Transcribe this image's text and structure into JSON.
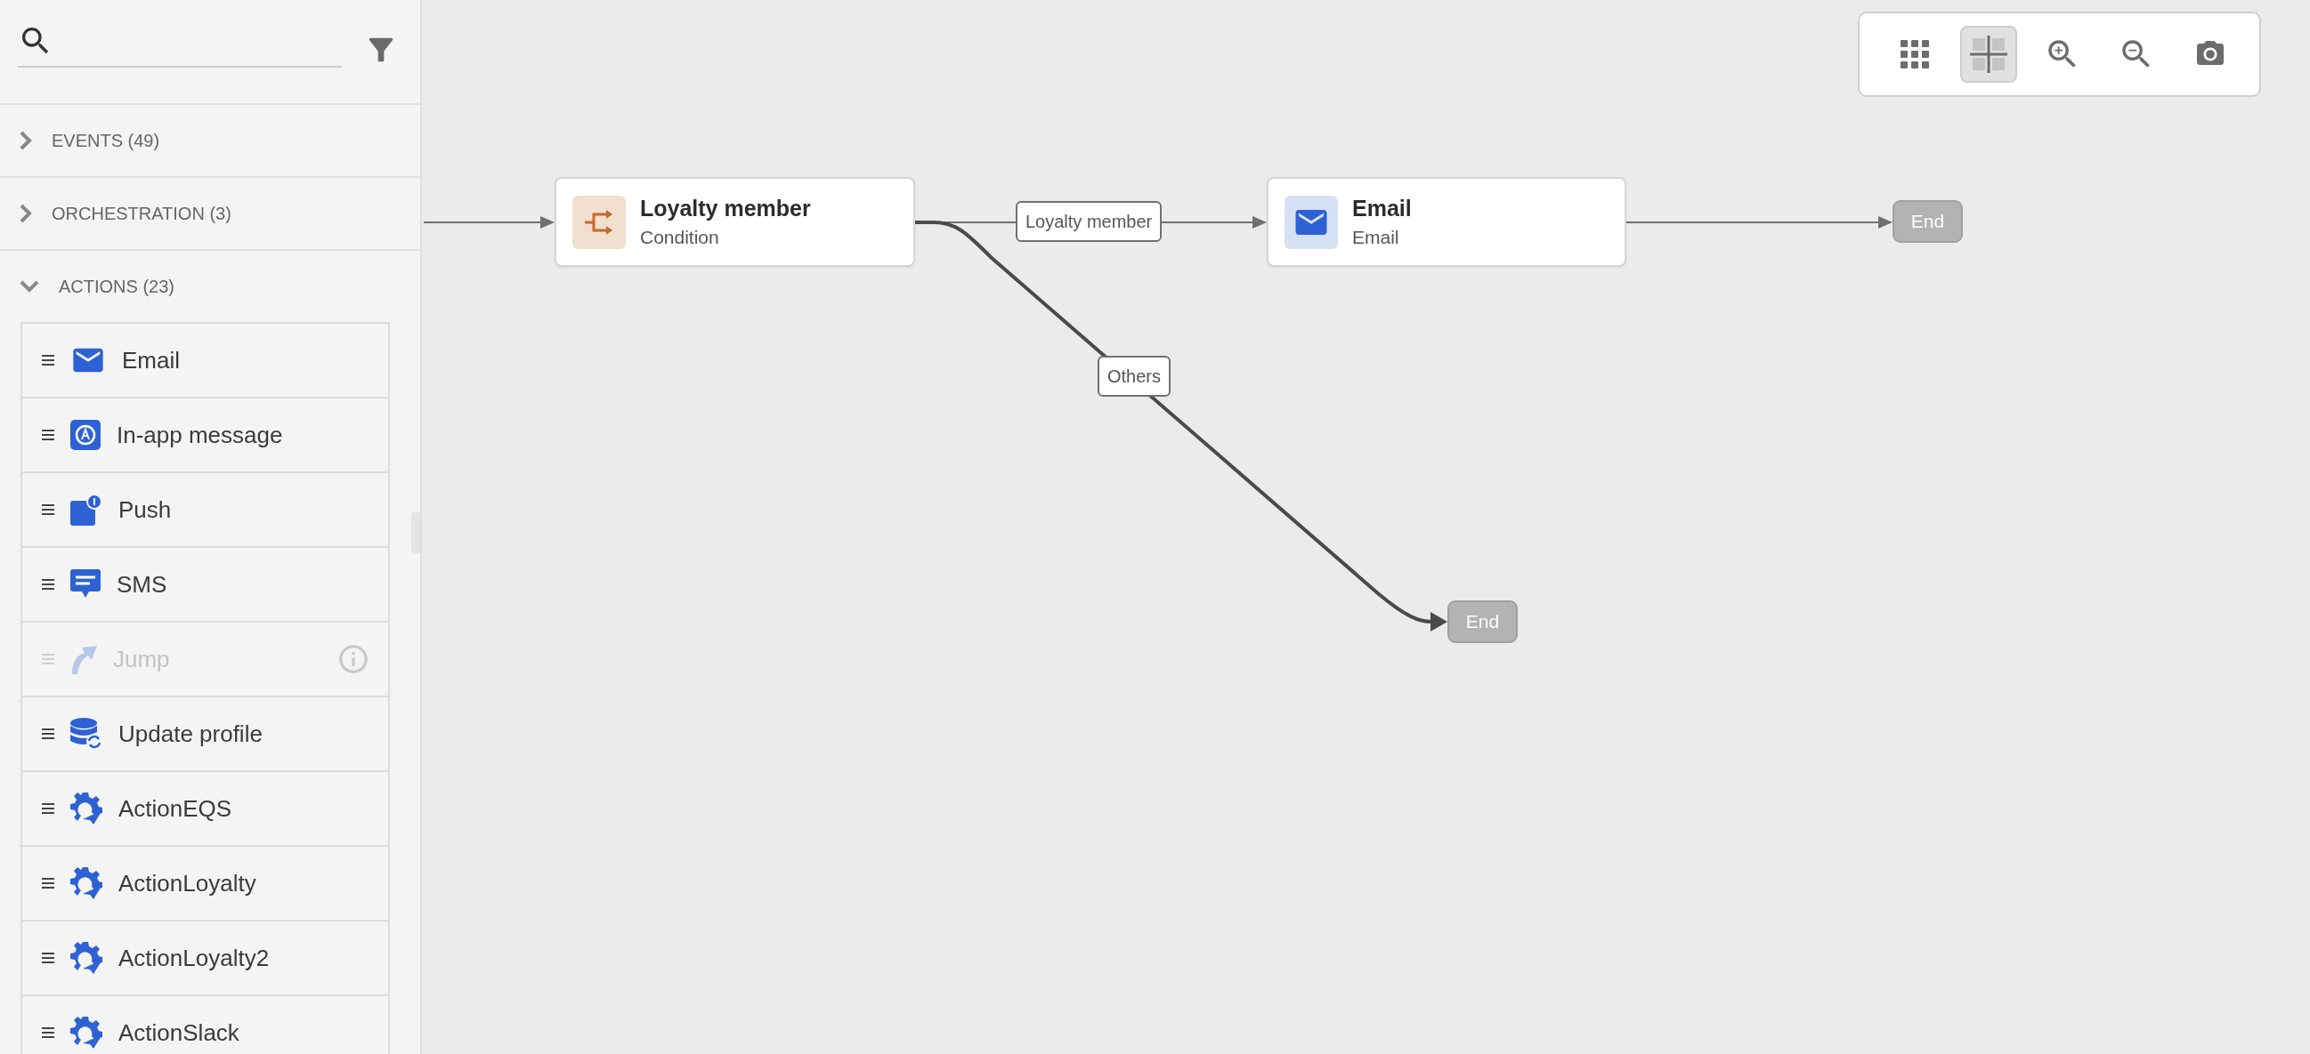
{
  "sidebar": {
    "sections": [
      {
        "label": "EVENTS (49)",
        "expanded": false
      },
      {
        "label": "ORCHESTRATION (3)",
        "expanded": false
      },
      {
        "label": "ACTIONS (23)",
        "expanded": true,
        "items": [
          {
            "label": "Email",
            "kind": "email",
            "disabled": false
          },
          {
            "label": "In-app message",
            "kind": "inapp",
            "disabled": false
          },
          {
            "label": "Push",
            "kind": "push",
            "disabled": false
          },
          {
            "label": "SMS",
            "kind": "sms",
            "disabled": false
          },
          {
            "label": "Jump",
            "kind": "jump",
            "disabled": true
          },
          {
            "label": "Update profile",
            "kind": "profile",
            "disabled": false
          },
          {
            "label": "ActionEQS",
            "kind": "custom",
            "disabled": false
          },
          {
            "label": "ActionLoyalty",
            "kind": "custom",
            "disabled": false
          },
          {
            "label": "ActionLoyalty2",
            "kind": "custom",
            "disabled": false
          },
          {
            "label": "ActionSlack",
            "kind": "custom",
            "disabled": false
          }
        ]
      }
    ]
  },
  "canvas": {
    "nodes": [
      {
        "kind": "condition",
        "title": "Loyalty member",
        "subtitle": "Condition"
      },
      {
        "kind": "email",
        "title": "Email",
        "subtitle": "Email"
      },
      {
        "kind": "end",
        "title": "End"
      },
      {
        "kind": "end",
        "title": "End"
      }
    ],
    "edge_labels": [
      "Loyalty member",
      "Others"
    ]
  },
  "toolbar": [
    {
      "kind": "grid",
      "selected": false
    },
    {
      "kind": "fit",
      "selected": true
    },
    {
      "kind": "zoom-in",
      "selected": false
    },
    {
      "kind": "zoom-out",
      "selected": false
    },
    {
      "kind": "capture",
      "selected": false
    }
  ]
}
